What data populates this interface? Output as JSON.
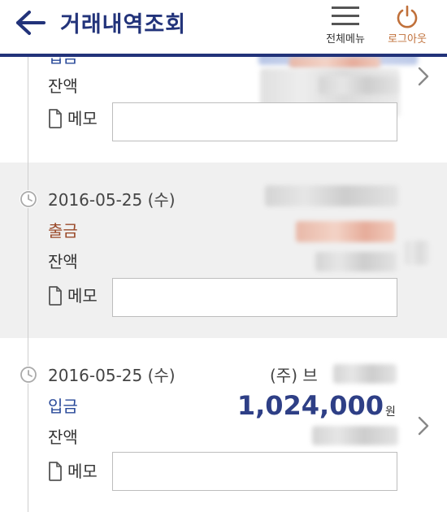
{
  "header": {
    "title": "거래내역조회",
    "menu_label": "전체메뉴",
    "logout_label": "로그아웃"
  },
  "colors": {
    "brand_navy": "#22337a",
    "withdrawal": "#9a4a2a",
    "deposit": "#2a4a9a",
    "logout": "#c0703a"
  },
  "transactions": [
    {
      "type_label": "입금",
      "balance_label": "잔액",
      "memo_label": "메모"
    },
    {
      "date": "2016-05-25 (수)",
      "type_label": "출금",
      "balance_label": "잔액",
      "memo_label": "메모"
    },
    {
      "date": "2016-05-25 (수)",
      "payee": "(주) 브",
      "type_label": "입금",
      "amount": "1,024,000",
      "currency": "원",
      "balance_label": "잔액",
      "memo_label": "메모"
    }
  ]
}
